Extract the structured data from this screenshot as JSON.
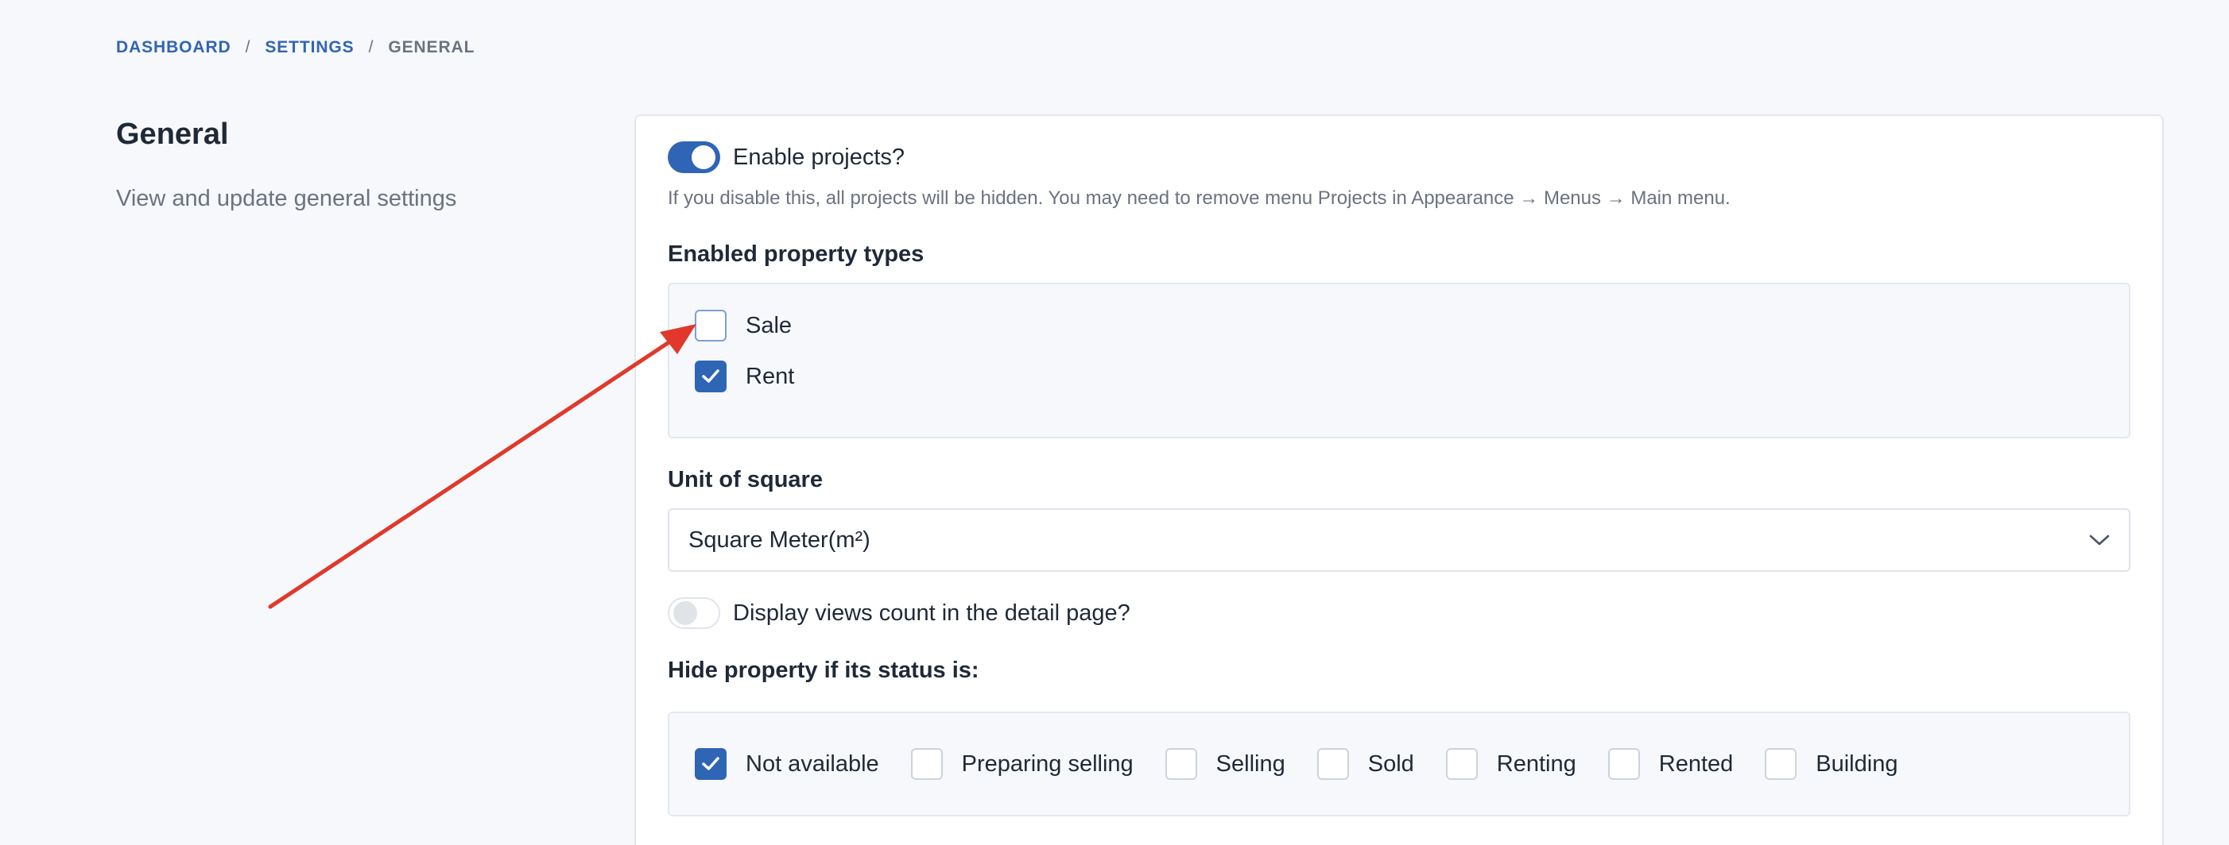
{
  "breadcrumb": {
    "items": [
      "DASHBOARD",
      "SETTINGS"
    ],
    "separator": "/",
    "current": "GENERAL"
  },
  "section": {
    "title": "General",
    "description": "View and update general settings"
  },
  "enable_projects": {
    "label": "Enable projects?",
    "checked": true,
    "help": "If you disable this, all projects will be hidden. You may need to remove menu Projects in Appearance → Menus → Main menu."
  },
  "property_types": {
    "label": "Enabled property types",
    "options": [
      {
        "label": "Sale",
        "checked": false
      },
      {
        "label": "Rent",
        "checked": true
      }
    ]
  },
  "unit_of_square": {
    "label": "Unit of square",
    "selected": "Square Meter(m²)"
  },
  "views_count": {
    "label": "Display views count in the detail page?",
    "checked": false
  },
  "hide_status": {
    "label": "Hide property if its status is:",
    "options": [
      {
        "label": "Not available",
        "checked": true
      },
      {
        "label": "Preparing selling",
        "checked": false
      },
      {
        "label": "Selling",
        "checked": false
      },
      {
        "label": "Sold",
        "checked": false
      },
      {
        "label": "Renting",
        "checked": false
      },
      {
        "label": "Rented",
        "checked": false
      },
      {
        "label": "Building",
        "checked": false
      }
    ]
  },
  "colors": {
    "accent": "#2f65b5",
    "annotation_arrow": "#e0392b"
  },
  "icons": {
    "check": "check-icon",
    "chevron": "chevron-down-icon"
  }
}
